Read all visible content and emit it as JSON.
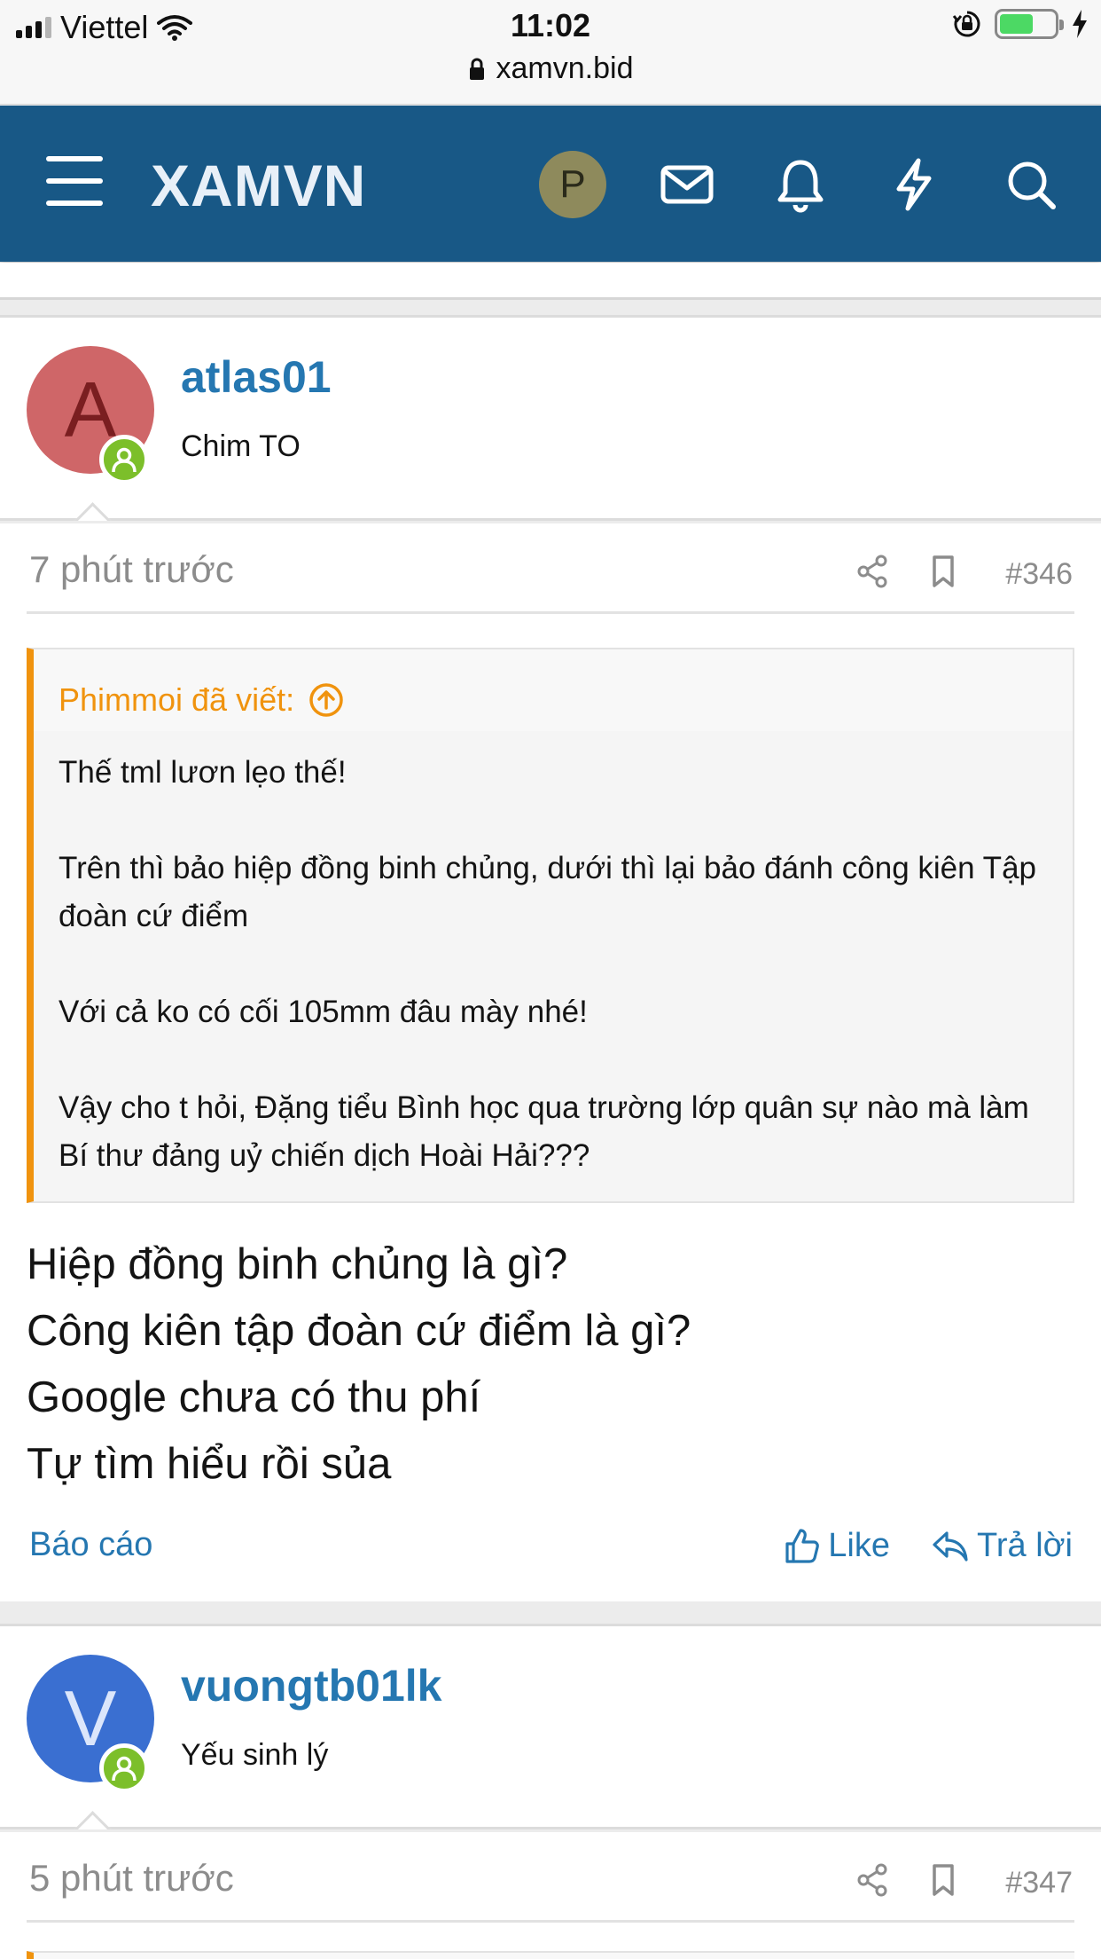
{
  "status_bar": {
    "carrier": "Viettel",
    "time": "11:02",
    "url": "xamvn.bid"
  },
  "header": {
    "logo": "XAMVN",
    "avatar_letter": "P",
    "icons": [
      "menu-icon",
      "mail-icon",
      "bell-icon",
      "lightning-icon",
      "search-icon"
    ]
  },
  "posts": [
    {
      "avatar_letter": "A",
      "avatar_color": "#cf6668",
      "avatar_letter_color": "#7a1e20",
      "username": "atlas01",
      "user_title": "Chim TO",
      "time": "7 phút trước",
      "post_number": "#346",
      "quote": {
        "author_label": "Phimmoi đã viết:",
        "lines": [
          "Thế tml lươn lẹo thế!",
          "Trên thì bảo hiệp đồng binh chủng, dưới thì lại bảo đánh công kiên Tập đoàn cứ điểm",
          "Với cả ko có cối 105mm đâu mày nhé!",
          "Vậy cho t hỏi, Đặng tiểu Bình học qua trường lớp quân sự nào mà làm Bí thư đảng uỷ chiến dịch Hoài Hải???"
        ]
      },
      "message_lines": [
        "Hiệp đồng binh chủng là gì?",
        "Công kiên tập đoàn cứ điểm là gì?",
        "Google chưa có thu phí",
        "Tự tìm hiểu rồi sủa"
      ],
      "actions": {
        "report": "Báo cáo",
        "like": "Like",
        "reply": "Trả lời"
      }
    },
    {
      "avatar_letter": "V",
      "avatar_color": "#3a6fd1",
      "avatar_letter_color": "#dbe6fb",
      "username": "vuongtb01lk",
      "user_title": "Yếu sinh lý",
      "time": "5 phút trước",
      "post_number": "#347"
    }
  ],
  "colors": {
    "header_bg": "#185886",
    "link": "#2577b1",
    "quote_accent": "#f0930e",
    "online": "#7cbf2a"
  }
}
